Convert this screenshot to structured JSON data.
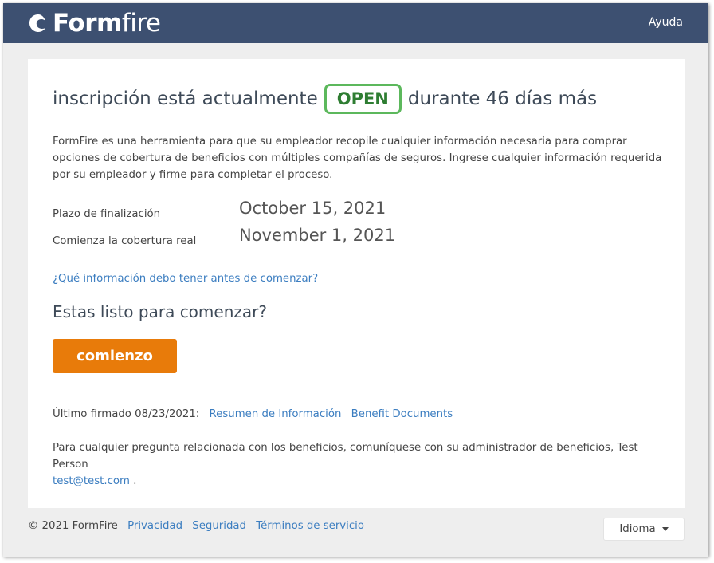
{
  "header": {
    "logo_bold": "Form",
    "logo_light": "fire",
    "help_label": "Ayuda"
  },
  "enrollment": {
    "prefix": "inscripción está actualmente",
    "status": "OPEN",
    "suffix": "durante 46 días más",
    "status_color": "#5cb85c"
  },
  "description": "FormFire es una herramienta para que su empleador recopile cualquier información necesaria para comprar opciones de cobertura de beneficios con múltiples compañías de seguros. Ingrese cualquier información requerida por su empleador y firme para completar el proceso.",
  "dates": {
    "deadline_label": "Plazo de finalización",
    "deadline_value": "October 15, 2021",
    "coverage_label": "Comienza la cobertura real",
    "coverage_value": "November 1, 2021"
  },
  "info_link": "¿Qué información debo tener antes de comenzar?",
  "ready_text": "Estas listo para comenzar?",
  "start_button": "comienzo",
  "start_button_color": "#e87b0a",
  "signed": {
    "text": "Último firmado 08/23/2021:",
    "summary_link": "Resumen de Información",
    "documents_link": "Benefit Documents"
  },
  "contact": {
    "text": "Para cualquier pregunta relacionada con los beneficios, comuníquese con su administrador de beneficios, Test Person",
    "email": "test@test.com",
    "end": "."
  },
  "footer": {
    "copyright": "© 2021 FormFire",
    "privacy": "Privacidad",
    "security": "Seguridad",
    "terms": "Términos de servicio",
    "language": "Idioma"
  }
}
